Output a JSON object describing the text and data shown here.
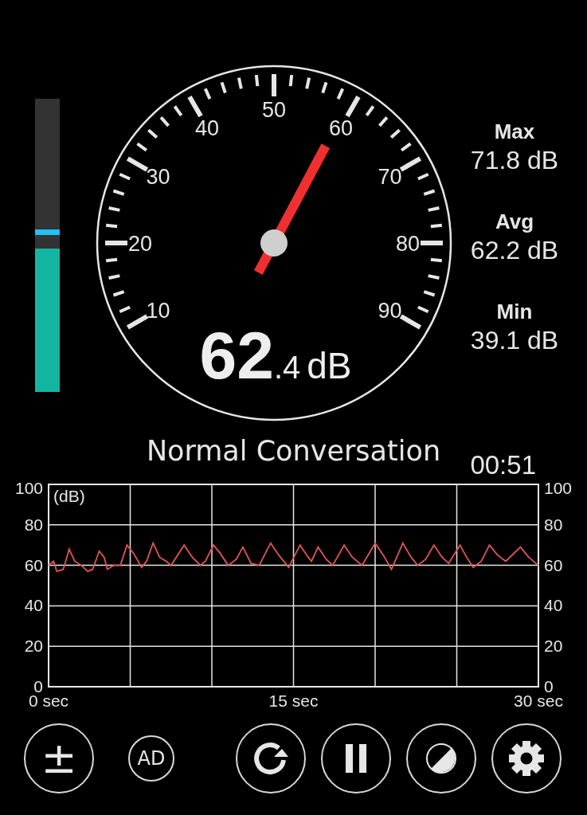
{
  "level_bar": {
    "level": 0.49,
    "peak": {
      "level": 0.535
    }
  },
  "gauge": {
    "scale_labels": [
      "10",
      "20",
      "30",
      "40",
      "50",
      "60",
      "70",
      "80",
      "90"
    ],
    "reading": {
      "whole": "62",
      "fraction": ".4",
      "unit": "dB"
    }
  },
  "stats": [
    {
      "label": "Max",
      "value": "71.8 dB"
    },
    {
      "label": "Avg",
      "value": "62.2 dB"
    },
    {
      "label": "Min",
      "value": "39.1 dB"
    }
  ],
  "noise_category": "Normal Conversation",
  "elapsed_time": "00:51",
  "history": {
    "right_axis_labels": [
      "100",
      "80",
      "60",
      "40",
      "20",
      "0"
    ],
    "chart_data": {
      "type": "line",
      "ylabel": "(dB)",
      "xlim": [
        0,
        30
      ],
      "ylim": [
        0,
        100
      ],
      "grid": true,
      "yticks": [
        0,
        20,
        40,
        60,
        80,
        100
      ],
      "xticks": [
        {
          "value": 0,
          "label": "0 sec"
        },
        {
          "value": 15,
          "label": "15 sec"
        },
        {
          "value": 30,
          "label": "30 sec"
        }
      ],
      "x": [
        0,
        0.3,
        0.5,
        0.9,
        1.26,
        1.6,
        2.0,
        2.4,
        2.7,
        3.1,
        3.4,
        3.6,
        4.0,
        4.4,
        4.8,
        5.2,
        5.7,
        6.0,
        6.4,
        6.8,
        7.2,
        7.5,
        8.3,
        8.8,
        9.3,
        9.6,
        10.1,
        10.5,
        11.0,
        11.5,
        11.9,
        12.4,
        12.9,
        13.6,
        14.1,
        14.7,
        15.4,
        15.9,
        16.1,
        16.5,
        17.0,
        17.4,
        18.1,
        18.6,
        19.2,
        20.0,
        20.5,
        21.0,
        21.7,
        22.2,
        22.6,
        23.1,
        23.6,
        24.1,
        24.5,
        25.2,
        25.6,
        26.0,
        26.5,
        27.0,
        27.5,
        28.0,
        28.9,
        29.4,
        30.0
      ],
      "series": [
        {
          "color": "#e05555",
          "values": [
            60,
            62,
            57,
            58,
            68,
            62,
            60,
            57,
            58,
            67,
            64,
            58,
            60,
            60,
            70,
            66,
            59,
            62,
            71,
            64,
            62,
            60,
            70,
            64,
            60,
            62,
            70,
            66,
            60,
            63,
            69,
            61,
            60,
            71,
            65,
            59,
            70,
            64,
            62,
            69,
            63,
            60,
            70,
            64,
            60,
            71,
            65,
            58,
            71,
            64,
            60,
            63,
            70,
            64,
            61,
            70,
            64,
            59,
            62,
            70,
            65,
            62,
            69,
            64,
            60
          ]
        }
      ]
    }
  },
  "buttons": [
    {
      "kind": "calibrate",
      "label": "±"
    },
    {
      "kind": "ad",
      "label": "AD"
    },
    {
      "kind": "reset"
    },
    {
      "kind": "pause"
    },
    {
      "kind": "theme"
    },
    {
      "kind": "settings"
    }
  ]
}
